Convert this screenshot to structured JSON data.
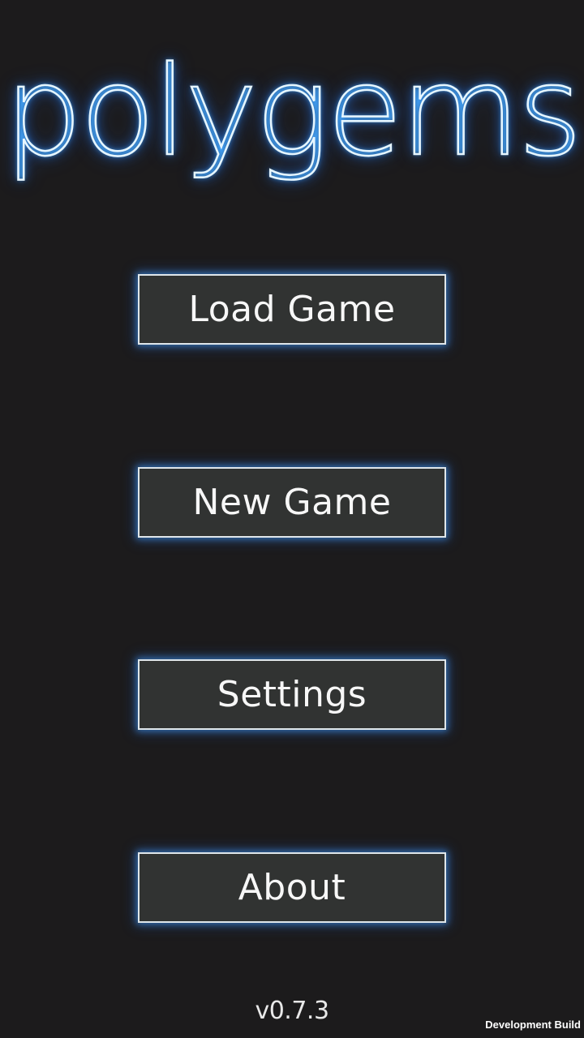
{
  "game": {
    "title": "polygems"
  },
  "menu": {
    "load_game": "Load Game",
    "new_game": "New Game",
    "settings": "Settings",
    "about": "About"
  },
  "footer": {
    "version": "v0.7.3",
    "build_label": "Development Build"
  },
  "colors": {
    "background": "#1c1b1c",
    "button_fill": "#313332",
    "button_border": "#dfe6ea",
    "glow": "#3c8cff"
  }
}
